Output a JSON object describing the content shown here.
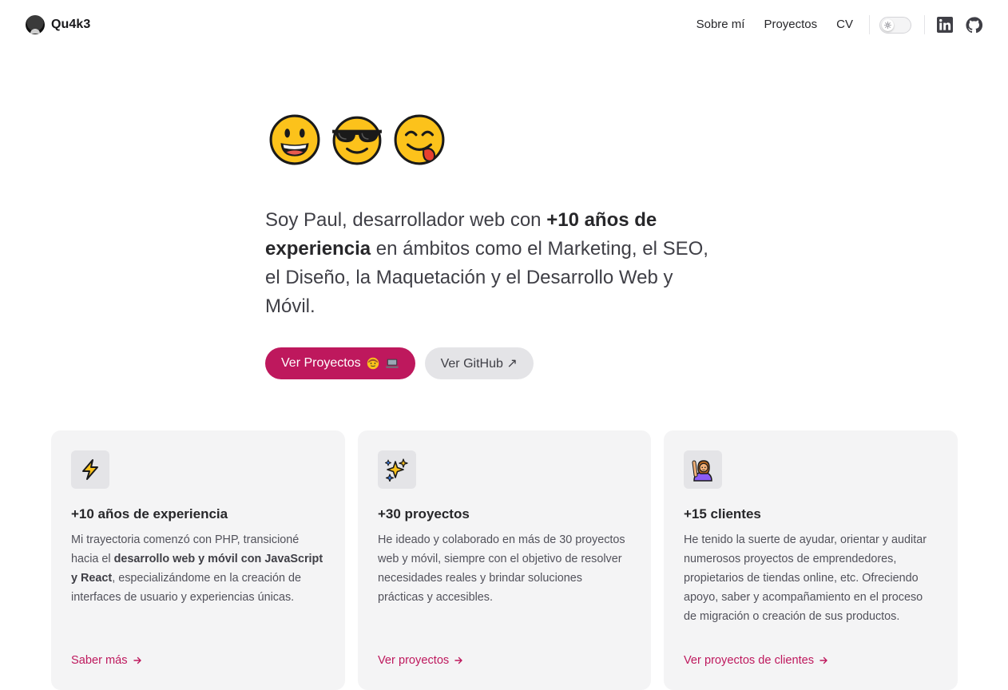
{
  "header": {
    "brand": "Qu4k3",
    "nav": [
      "Sobre mí",
      "Proyectos",
      "CV"
    ],
    "theme_toggle": "light",
    "social": [
      "linkedin-icon",
      "github-icon"
    ]
  },
  "hero": {
    "emojis": [
      "grinning-face",
      "smiling-face-with-sunglasses",
      "face-savoring-food"
    ],
    "intro_1": "Soy Paul, desarrollador web con ",
    "intro_bold_1": "+10 años de experiencia",
    "intro_2": " en ámbitos como el Marketing, el SEO, el Diseño, la Maquetación y el Desarrollo Web y Móvil.",
    "primary_cta": "Ver Proyectos",
    "secondary_cta": "Ver GitHub ↗"
  },
  "cards": [
    {
      "icon": "lightning-icon",
      "title": "+10 años de experiencia",
      "text_1": "Mi trayectoria comenzó con PHP, transicioné hacia el ",
      "text_bold": "desarrollo web y móvil con JavaScript y React",
      "text_2": ", especializándome en la creación de interfaces de usuario y experiencias únicas.",
      "link": "Saber más"
    },
    {
      "icon": "sparkles-icon",
      "title": "+30 proyectos",
      "text": "He ideado y colaborado en más de 30 proyectos web y móvil, siempre con el objetivo de resolver necesidades reales y brindar soluciones prácticas y accesibles.",
      "link": "Ver proyectos"
    },
    {
      "icon": "person-raising-hand-icon",
      "title": "+15 clientes",
      "text": "He tenido la suerte de ayudar, orientar y auditar numerosos proyectos de emprendedores, propietarios de tiendas online, etc. Ofreciendo apoyo, saber y acompañamiento en el proceso de migración o creación de sus productos.",
      "link": "Ver proyectos de clientes"
    }
  ],
  "colors": {
    "accent": "#be185d",
    "card_bg": "#f4f4f5",
    "text": "#27272a"
  }
}
